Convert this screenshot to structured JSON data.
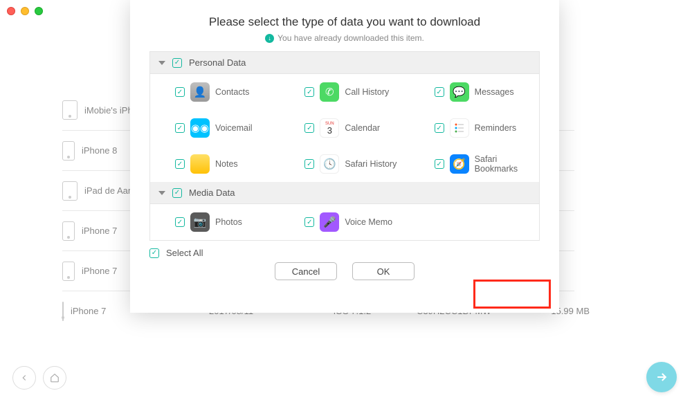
{
  "modal": {
    "title": "Please select the type of data you want to download",
    "subtitle": "You have already downloaded this item.",
    "sections": {
      "personal": {
        "label": "Personal Data",
        "items": {
          "contacts": "Contacts",
          "callhistory": "Call History",
          "messages": "Messages",
          "voicemail": "Voicemail",
          "calendar": "Calendar",
          "reminders": "Reminders",
          "notes": "Notes",
          "safarihistory": "Safari History",
          "safaribookmarks": "Safari Bookmarks"
        }
      },
      "media": {
        "label": "Media Data",
        "items": {
          "photos": "Photos",
          "voicememo": "Voice Memo"
        }
      }
    },
    "select_all": "Select All",
    "cancel": "Cancel",
    "ok": "OK"
  },
  "devices": [
    {
      "name": "iMobie's iPhone"
    },
    {
      "name": "iPhone 8"
    },
    {
      "name": "iPad de Aaron",
      "tablet": true
    },
    {
      "name": "iPhone 7"
    },
    {
      "name": "iPhone 7"
    },
    {
      "name": "iPhone 7",
      "date": "2017/08/11",
      "os": "iOS 7.1.2",
      "serial": "C39H2CC1DPMW",
      "size": "15.99 MB"
    }
  ]
}
